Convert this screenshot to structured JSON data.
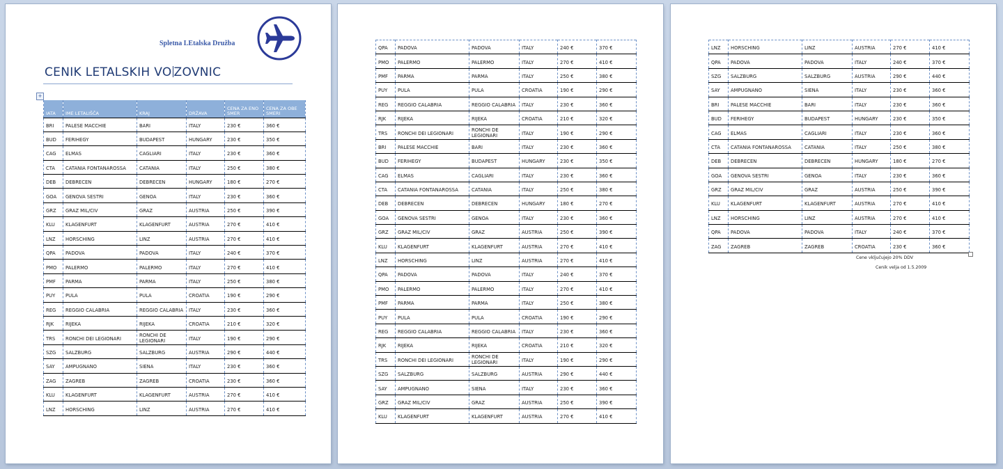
{
  "header": {
    "brand_text": "Spletna LEtalska Družba",
    "title_before_cursor": "CENIK LETALSKIH VO",
    "title_after_cursor": "ZOVNIC",
    "logo_icon": "airplane-icon",
    "brand_color": "#2b3a98"
  },
  "table": {
    "columns": [
      "IATA",
      "IME LETALIŠČA",
      "KRAJ",
      "DRŽAVA",
      "CENA ZA ENO SMER",
      "CENA ZA OBE SMERI"
    ],
    "header_color": "#8eb0da"
  },
  "pages": [
    {
      "rows": [
        [
          "BRI",
          "PALESE MACCHIE",
          "BARI",
          "ITALY",
          "230 €",
          "360 €"
        ],
        [
          "BUD",
          "FERIHEGY",
          "BUDAPEST",
          "HUNGARY",
          "230 €",
          "350 €"
        ],
        [
          "CAG",
          "ELMAS",
          "CAGLIARI",
          "ITALY",
          "230 €",
          "360 €"
        ],
        [
          "CTA",
          "CATANIA FONTANAROSSA",
          "CATANIA",
          "ITALY",
          "250 €",
          "380 €"
        ],
        [
          "DEB",
          "DEBRECEN",
          "DEBRECEN",
          "HUNGARY",
          "180 €",
          "270 €"
        ],
        [
          "GOA",
          "GENOVA SESTRI",
          "GENOA",
          "ITALY",
          "230 €",
          "360 €"
        ],
        [
          "GRZ",
          "GRAZ MIL/CIV",
          "GRAZ",
          "AUSTRIA",
          "250 €",
          "390 €"
        ],
        [
          "KLU",
          "KLAGENFURT",
          "KLAGENFURT",
          "AUSTRIA",
          "270 €",
          "410 €"
        ],
        [
          "LNZ",
          "HORSCHING",
          "LINZ",
          "AUSTRIA",
          "270 €",
          "410 €"
        ],
        [
          "QPA",
          "PADOVA",
          "PADOVA",
          "ITALY",
          "240 €",
          "370 €"
        ],
        [
          "PMO",
          "PALERMO",
          "PALERMO",
          "ITALY",
          "270 €",
          "410 €"
        ],
        [
          "PMF",
          "PARMA",
          "PARMA",
          "ITALY",
          "250 €",
          "380 €"
        ],
        [
          "PUY",
          "PULA",
          "PULA",
          "CROATIA",
          "190 €",
          "290 €"
        ],
        [
          "REG",
          "REGGIO CALABRIA",
          "REGGIO CALABRIA",
          "ITALY",
          "230 €",
          "360 €"
        ],
        [
          "RJK",
          "RIJEKA",
          "RIJEKA",
          "CROATIA",
          "210 €",
          "320 €"
        ],
        [
          "TRS",
          "RONCHI DEI LEGIONARI",
          "RONCHI DE LEGIONARI",
          "ITALY",
          "190 €",
          "290 €"
        ],
        [
          "SZG",
          "SALZBURG",
          "SALZBURG",
          "AUSTRIA",
          "290 €",
          "440 €"
        ],
        [
          "SAY",
          "AMPUGNANO",
          "SIENA",
          "ITALY",
          "230 €",
          "360 €"
        ],
        [
          "ZAG",
          "ZAGREB",
          "ZAGREB",
          "CROATIA",
          "230 €",
          "360 €"
        ],
        [
          "KLU",
          "KLAGENFURT",
          "KLAGENFURT",
          "AUSTRIA",
          "270 €",
          "410 €"
        ],
        [
          "LNZ",
          "HORSCHING",
          "LINZ",
          "AUSTRIA",
          "270 €",
          "410 €"
        ]
      ]
    },
    {
      "rows": [
        [
          "QPA",
          "PADOVA",
          "PADOVA",
          "ITALY",
          "240 €",
          "370 €"
        ],
        [
          "PMO",
          "PALERMO",
          "PALERMO",
          "ITALY",
          "270 €",
          "410 €"
        ],
        [
          "PMF",
          "PARMA",
          "PARMA",
          "ITALY",
          "250 €",
          "380 €"
        ],
        [
          "PUY",
          "PULA",
          "PULA",
          "CROATIA",
          "190 €",
          "290 €"
        ],
        [
          "REG",
          "REGGIO CALABRIA",
          "REGGIO CALABRIA",
          "ITALY",
          "230 €",
          "360 €"
        ],
        [
          "RJK",
          "RIJEKA",
          "RIJEKA",
          "CROATIA",
          "210 €",
          "320 €"
        ],
        [
          "TRS",
          "RONCHI DEI LEGIONARI",
          "RONCHI DE LEGIONARI",
          "ITALY",
          "190 €",
          "290 €"
        ],
        [
          "BRI",
          "PALESE MACCHIE",
          "BARI",
          "ITALY",
          "230 €",
          "360 €"
        ],
        [
          "BUD",
          "FERIHEGY",
          "BUDAPEST",
          "HUNGARY",
          "230 €",
          "350 €"
        ],
        [
          "CAG",
          "ELMAS",
          "CAGLIARI",
          "ITALY",
          "230 €",
          "360 €"
        ],
        [
          "CTA",
          "CATANIA FONTANAROSSA",
          "CATANIA",
          "ITALY",
          "250 €",
          "380 €"
        ],
        [
          "DEB",
          "DEBRECEN",
          "DEBRECEN",
          "HUNGARY",
          "180 €",
          "270 €"
        ],
        [
          "GOA",
          "GENOVA SESTRI",
          "GENOA",
          "ITALY",
          "230 €",
          "360 €"
        ],
        [
          "GRZ",
          "GRAZ MIL/CIV",
          "GRAZ",
          "AUSTRIA",
          "250 €",
          "390 €"
        ],
        [
          "KLU",
          "KLAGENFURT",
          "KLAGENFURT",
          "AUSTRIA",
          "270 €",
          "410 €"
        ],
        [
          "LNZ",
          "HORSCHING",
          "LINZ",
          "AUSTRIA",
          "270 €",
          "410 €"
        ],
        [
          "QPA",
          "PADOVA",
          "PADOVA",
          "ITALY",
          "240 €",
          "370 €"
        ],
        [
          "PMO",
          "PALERMO",
          "PALERMO",
          "ITALY",
          "270 €",
          "410 €"
        ],
        [
          "PMF",
          "PARMA",
          "PARMA",
          "ITALY",
          "250 €",
          "380 €"
        ],
        [
          "PUY",
          "PULA",
          "PULA",
          "CROATIA",
          "190 €",
          "290 €"
        ],
        [
          "REG",
          "REGGIO CALABRIA",
          "REGGIO CALABRIA",
          "ITALY",
          "230 €",
          "360 €"
        ],
        [
          "RJK",
          "RIJEKA",
          "RIJEKA",
          "CROATIA",
          "210 €",
          "320 €"
        ],
        [
          "TRS",
          "RONCHI DEI LEGIONARI",
          "RONCHI DE LEGIONARI",
          "ITALY",
          "190 €",
          "290 €"
        ],
        [
          "SZG",
          "SALZBURG",
          "SALZBURG",
          "AUSTRIA",
          "290 €",
          "440 €"
        ],
        [
          "SAY",
          "AMPUGNANO",
          "SIENA",
          "ITALY",
          "230 €",
          "360 €"
        ],
        [
          "GRZ",
          "GRAZ MIL/CIV",
          "GRAZ",
          "AUSTRIA",
          "250 €",
          "390 €"
        ],
        [
          "KLU",
          "KLAGENFURT",
          "KLAGENFURT",
          "AUSTRIA",
          "270 €",
          "410 €"
        ]
      ]
    },
    {
      "rows": [
        [
          "LNZ",
          "HORSCHING",
          "LINZ",
          "AUSTRIA",
          "270 €",
          "410 €"
        ],
        [
          "QPA",
          "PADOVA",
          "PADOVA",
          "ITALY",
          "240 €",
          "370 €"
        ],
        [
          "SZG",
          "SALZBURG",
          "SALZBURG",
          "AUSTRIA",
          "290 €",
          "440 €"
        ],
        [
          "SAY",
          "AMPUGNANO",
          "SIENA",
          "ITALY",
          "230 €",
          "360 €"
        ],
        [
          "BRI",
          "PALESE MACCHIE",
          "BARI",
          "ITALY",
          "230 €",
          "360 €"
        ],
        [
          "BUD",
          "FERIHEGY",
          "BUDAPEST",
          "HUNGARY",
          "230 €",
          "350 €"
        ],
        [
          "CAG",
          "ELMAS",
          "CAGLIARI",
          "ITALY",
          "230 €",
          "360 €"
        ],
        [
          "CTA",
          "CATANIA FONTANAROSSA",
          "CATANIA",
          "ITALY",
          "250 €",
          "380 €"
        ],
        [
          "DEB",
          "DEBRECEN",
          "DEBRECEN",
          "HUNGARY",
          "180 €",
          "270 €"
        ],
        [
          "GOA",
          "GENOVA SESTRI",
          "GENOA",
          "ITALY",
          "230 €",
          "360 €"
        ],
        [
          "GRZ",
          "GRAZ MIL/CIV",
          "GRAZ",
          "AUSTRIA",
          "250 €",
          "390 €"
        ],
        [
          "KLU",
          "KLAGENFURT",
          "KLAGENFURT",
          "AUSTRIA",
          "270 €",
          "410 €"
        ],
        [
          "LNZ",
          "HORSCHING",
          "LINZ",
          "AUSTRIA",
          "270 €",
          "410 €"
        ],
        [
          "QPA",
          "PADOVA",
          "PADOVA",
          "ITALY",
          "240 €",
          "370 €"
        ],
        [
          "ZAG",
          "ZAGREB",
          "ZAGREB",
          "CROATIA",
          "230 €",
          "360 €"
        ]
      ]
    }
  ],
  "footer": {
    "note_vat": "Cene vključujejo 20% DDV",
    "note_valid": "Cenik velja od 1.5.2009"
  }
}
